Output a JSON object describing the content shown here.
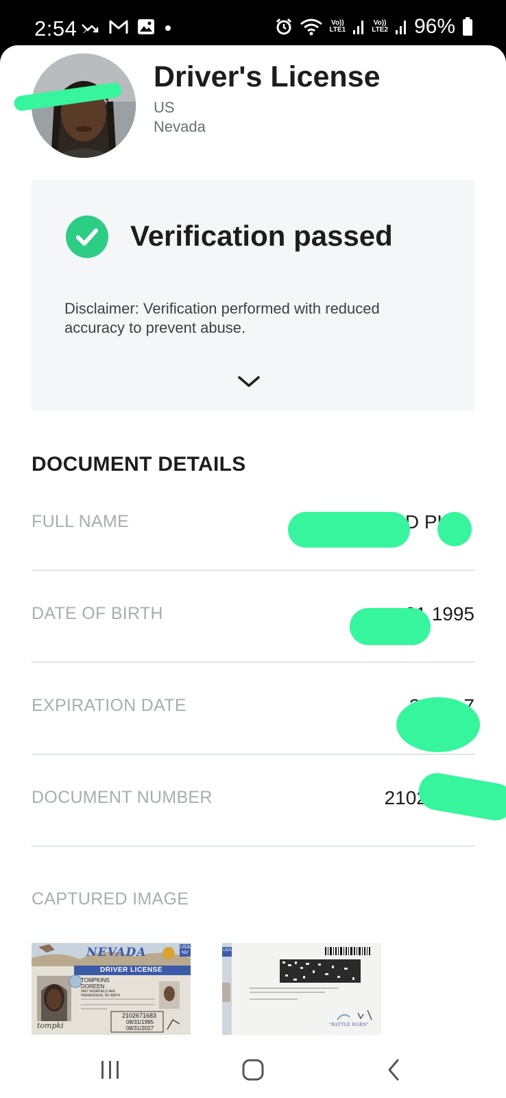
{
  "status_bar": {
    "time": "2:54",
    "battery": "96%",
    "network_1": "LTE1",
    "network_2": "LTE2",
    "volte": "Vo))",
    "icons": [
      "missed-call-icon",
      "gmail-icon",
      "photo-icon",
      "dot-icon",
      "alarm-icon",
      "wifi-icon",
      "signal-icon",
      "battery-icon"
    ]
  },
  "header": {
    "title": "Driver's License",
    "country": "US",
    "state": "Nevada"
  },
  "verification": {
    "status": "Verification passed",
    "disclaimer": "Disclaimer: Verification performed with reduced accuracy to prevent abuse.",
    "accent_color": "#2dcd86"
  },
  "details": {
    "section_title": "DOCUMENT DETAILS",
    "rows": [
      {
        "label": "FULL NAME",
        "value": "D          PKI"
      },
      {
        "label": "DATE OF BIRTH",
        "value": "31        1995"
      },
      {
        "label": "EXPIRATION DATE",
        "value": "31 Au       7"
      },
      {
        "label": "DOCUMENT NUMBER",
        "value": "210267"
      }
    ],
    "captured_label": "CAPTURED IMAGE"
  },
  "license_front": {
    "state": "NEVADA",
    "banner": "DRIVER LICENSE",
    "usa": "USA",
    "nv": "NV",
    "last_name": "TOMPKINS",
    "first_name": "DOREEN",
    "address_1": "3467 MUIRFIELD AVE",
    "address_2": "HENDERSON, NV 89074",
    "dl_number": "2102671683",
    "dob": "08/31/1995",
    "exp": "08/31/2027",
    "signature": "tompki"
  },
  "license_back": {
    "usa": "USA",
    "footer": "\"BATTLE BORN\""
  },
  "redaction_color": "#37f59c"
}
